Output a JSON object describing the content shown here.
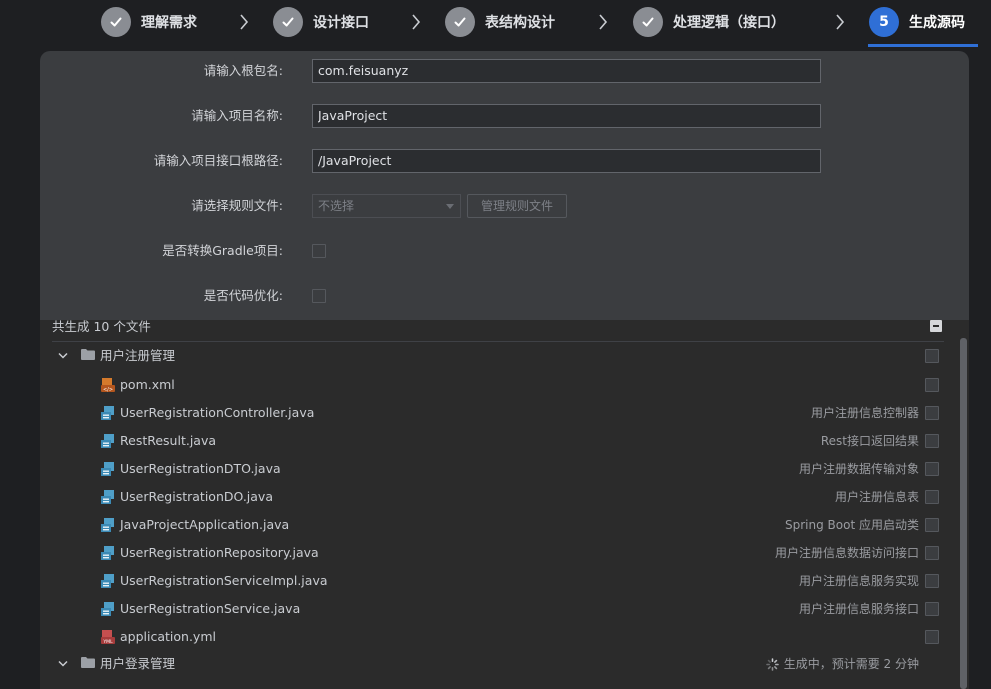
{
  "stepper": {
    "steps": [
      {
        "label": "理解需求",
        "state": "done"
      },
      {
        "label": "设计接口",
        "state": "done"
      },
      {
        "label": "表结构设计",
        "state": "done"
      },
      {
        "label": "处理逻辑（接口）",
        "state": "done"
      },
      {
        "label": "生成源码",
        "state": "active",
        "number": "5"
      }
    ]
  },
  "form": {
    "package_label": "请输入根包名:",
    "package_value": "com.feisuanyz",
    "project_name_label": "请输入项目名称:",
    "project_name_value": "JavaProject",
    "api_root_label": "请输入项目接口根路径:",
    "api_root_value": "/JavaProject",
    "rule_file_label": "请选择规则文件:",
    "rule_file_value": "不选择",
    "manage_rules_button": "管理规则文件",
    "gradle_label": "是否转换Gradle项目:",
    "gradle_checked": false,
    "optimize_label": "是否代码优化:",
    "optimize_checked": false
  },
  "tree": {
    "header": "共生成 10 个文件",
    "modules": [
      {
        "name": "用户注册管理",
        "expanded": true,
        "files": [
          {
            "name": "pom.xml",
            "type": "xml",
            "desc": ""
          },
          {
            "name": "UserRegistrationController.java",
            "type": "java",
            "desc": "用户注册信息控制器"
          },
          {
            "name": "RestResult.java",
            "type": "java",
            "desc": "Rest接口返回结果"
          },
          {
            "name": "UserRegistrationDTO.java",
            "type": "java",
            "desc": "用户注册数据传输对象"
          },
          {
            "name": "UserRegistrationDO.java",
            "type": "java",
            "desc": "用户注册信息表"
          },
          {
            "name": "JavaProjectApplication.java",
            "type": "java",
            "desc": "Spring Boot 应用启动类"
          },
          {
            "name": "UserRegistrationRepository.java",
            "type": "java",
            "desc": "用户注册信息数据访问接口"
          },
          {
            "name": "UserRegistrationServiceImpl.java",
            "type": "java",
            "desc": "用户注册信息服务实现"
          },
          {
            "name": "UserRegistrationService.java",
            "type": "java",
            "desc": "用户注册信息服务接口"
          },
          {
            "name": "application.yml",
            "type": "yml",
            "desc": ""
          }
        ]
      },
      {
        "name": "用户登录管理",
        "expanded": true,
        "status": "生成中，预计需要 2 分钟",
        "files": []
      }
    ]
  },
  "colors": {
    "accent": "#2f6fd6",
    "done_step": "#8a8d93",
    "panel": "#3b3d40",
    "tree_bg": "#2b2b2b"
  }
}
